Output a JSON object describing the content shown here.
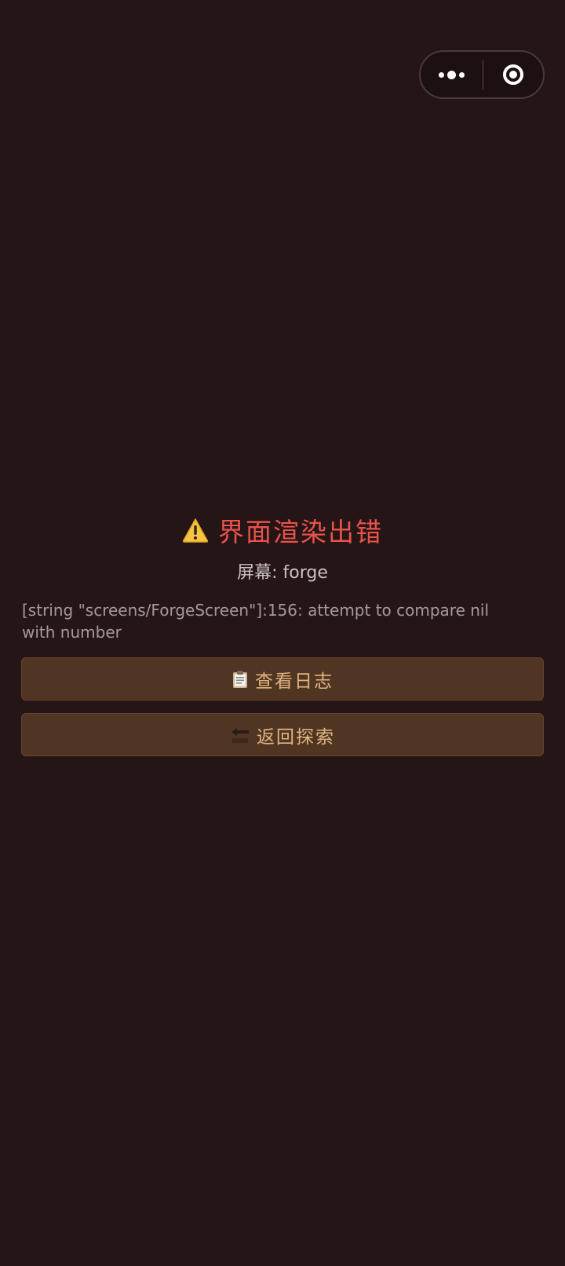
{
  "capsule": {
    "more_icon": "more-dots-icon",
    "close_icon": "target-circle-icon"
  },
  "error": {
    "icon": "warning-icon",
    "title": "界面渲染出错",
    "screen_line": "屏幕: forge",
    "message_line1": "[string \"screens/ForgeScreen\"]:156: attempt to compare nil",
    "message_line2": "with number"
  },
  "buttons": {
    "logs": {
      "icon": "clipboard-icon",
      "label": "查看日志"
    },
    "back": {
      "icon": "back-arrow-icon",
      "label": "返回探索"
    }
  },
  "colors": {
    "background": "#261516",
    "title_red": "#e8534b",
    "button_bg": "#503523",
    "button_text": "#e0b47f"
  }
}
